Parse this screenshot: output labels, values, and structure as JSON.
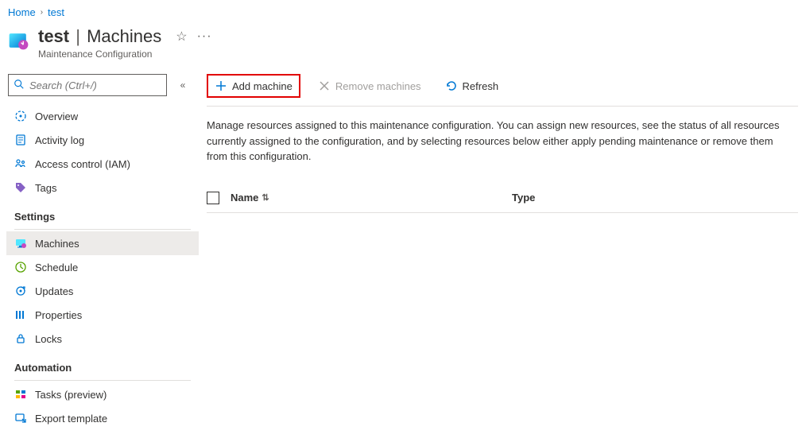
{
  "breadcrumb": {
    "home": "Home",
    "current": "test"
  },
  "header": {
    "resource_name": "test",
    "section": "Machines",
    "subtitle": "Maintenance Configuration"
  },
  "search": {
    "placeholder": "Search (Ctrl+/)"
  },
  "nav": {
    "top": [
      {
        "label": "Overview"
      },
      {
        "label": "Activity log"
      },
      {
        "label": "Access control (IAM)"
      },
      {
        "label": "Tags"
      }
    ],
    "settings_header": "Settings",
    "settings": [
      {
        "label": "Machines",
        "active": true
      },
      {
        "label": "Schedule"
      },
      {
        "label": "Updates"
      },
      {
        "label": "Properties"
      },
      {
        "label": "Locks"
      }
    ],
    "automation_header": "Automation",
    "automation": [
      {
        "label": "Tasks (preview)"
      },
      {
        "label": "Export template"
      }
    ]
  },
  "toolbar": {
    "add": "Add machine",
    "remove": "Remove machines",
    "refresh": "Refresh"
  },
  "description": "Manage resources assigned to this maintenance configuration. You can assign new resources, see the status of all resources currently assigned to the configuration, and by selecting resources below either apply pending maintenance or remove them from this configuration.",
  "table": {
    "columns": {
      "name": "Name",
      "type": "Type"
    },
    "rows": []
  }
}
